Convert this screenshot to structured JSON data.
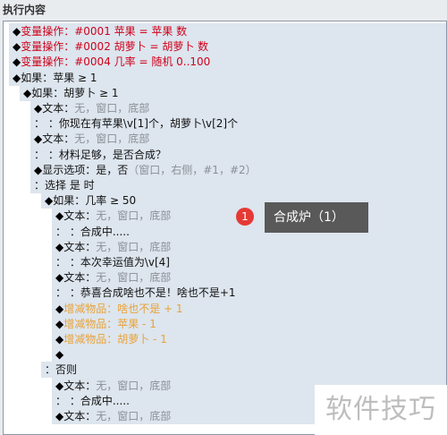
{
  "header": {
    "title": "执行内容"
  },
  "rows": [
    {
      "indent": 0,
      "seg": [
        [
          "◆",
          "dia"
        ],
        [
          "变量操作：#0001 苹果 = 苹果 数",
          "red"
        ]
      ]
    },
    {
      "indent": 0,
      "seg": [
        [
          "◆",
          "dia"
        ],
        [
          "变量操作：#0002 胡萝卜 = 胡萝卜 数",
          "red"
        ]
      ]
    },
    {
      "indent": 0,
      "seg": [
        [
          "◆",
          "dia"
        ],
        [
          "变量操作：#0004 几率 = 随机 0..100",
          "red"
        ]
      ]
    },
    {
      "indent": 0,
      "seg": [
        [
          "◆",
          "dia"
        ],
        [
          "如果：苹果 ≥ 1",
          "blk"
        ]
      ]
    },
    {
      "indent": 1,
      "seg": [
        [
          "◆",
          "dia"
        ],
        [
          "如果：胡萝卜 ≥ 1",
          "blk"
        ]
      ]
    },
    {
      "indent": 2,
      "seg": [
        [
          "◆",
          "dia"
        ],
        [
          "文本：",
          "blk"
        ],
        [
          "无，窗口，底部",
          "gry"
        ]
      ]
    },
    {
      "indent": 2,
      "seg": [
        [
          "：",
          "blk"
        ],
        [
          "      ：你现在有苹果\\v[1]个，胡萝卜\\v[2]个",
          "blk"
        ]
      ]
    },
    {
      "indent": 2,
      "seg": [
        [
          "◆",
          "dia"
        ],
        [
          "文本：",
          "blk"
        ],
        [
          "无，窗口，底部",
          "gry"
        ]
      ]
    },
    {
      "indent": 2,
      "seg": [
        [
          "：",
          "blk"
        ],
        [
          "      ：材料足够，是否合成？",
          "blk"
        ]
      ]
    },
    {
      "indent": 2,
      "seg": [
        [
          "◆",
          "dia"
        ],
        [
          "显示选项：是，否",
          "blk"
        ],
        [
          "（窗口，右侧，#1，#2）",
          "gry"
        ]
      ]
    },
    {
      "indent": 2,
      "seg": [
        [
          "：选择 是 时",
          "blk"
        ]
      ]
    },
    {
      "indent": 3,
      "seg": [
        [
          "◆",
          "dia"
        ],
        [
          "如果：几率 ≥ 50",
          "blk"
        ]
      ]
    },
    {
      "indent": 4,
      "seg": [
        [
          "◆",
          "dia"
        ],
        [
          "文本：",
          "blk"
        ],
        [
          "无，窗口，底部",
          "gry"
        ]
      ]
    },
    {
      "indent": 4,
      "seg": [
        [
          "：",
          "blk"
        ],
        [
          "      ：合成中.....",
          "blk"
        ]
      ]
    },
    {
      "indent": 4,
      "seg": [
        [
          "◆",
          "dia"
        ],
        [
          "文本：",
          "blk"
        ],
        [
          "无，窗口，底部",
          "gry"
        ]
      ]
    },
    {
      "indent": 4,
      "seg": [
        [
          "：",
          "blk"
        ],
        [
          "      ：本次幸运值为\\v[4]",
          "blk"
        ]
      ]
    },
    {
      "indent": 4,
      "seg": [
        [
          "◆",
          "dia"
        ],
        [
          "文本：",
          "blk"
        ],
        [
          "无，窗口，底部",
          "gry"
        ]
      ]
    },
    {
      "indent": 4,
      "seg": [
        [
          "：",
          "blk"
        ],
        [
          "      ：恭喜合成啥也不是！啥也不是+1",
          "blk"
        ]
      ]
    },
    {
      "indent": 4,
      "seg": [
        [
          "◆",
          "dia"
        ],
        [
          "增减物品：啥也不是 + 1",
          "org"
        ]
      ]
    },
    {
      "indent": 4,
      "seg": [
        [
          "◆",
          "dia"
        ],
        [
          "增减物品：苹果 - 1",
          "org"
        ]
      ]
    },
    {
      "indent": 4,
      "seg": [
        [
          "◆",
          "dia"
        ],
        [
          "增减物品：胡萝卜 - 1",
          "org"
        ]
      ]
    },
    {
      "indent": 4,
      "seg": [
        [
          "◆",
          "dia"
        ]
      ]
    },
    {
      "indent": 3,
      "seg": [
        [
          "：否则",
          "blk"
        ]
      ]
    },
    {
      "indent": 4,
      "seg": [
        [
          "◆",
          "dia"
        ],
        [
          "文本：",
          "blk"
        ],
        [
          "无，窗口，底部",
          "gry"
        ]
      ]
    },
    {
      "indent": 4,
      "seg": [
        [
          "：",
          "blk"
        ],
        [
          "      ：合成中.....",
          "blk"
        ]
      ]
    },
    {
      "indent": 4,
      "seg": [
        [
          "◆",
          "dia"
        ],
        [
          "文本：",
          "blk"
        ],
        [
          "无，窗口，底部",
          "gry"
        ]
      ]
    }
  ],
  "tooltip": {
    "badge": "1",
    "text": "合成炉（1）"
  },
  "watermark": {
    "text": "软件技巧"
  }
}
